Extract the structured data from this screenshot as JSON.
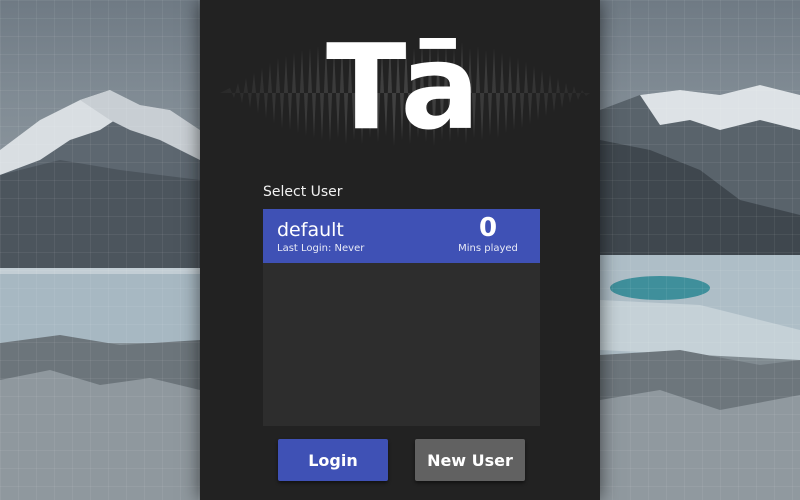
{
  "app": {
    "logo": "Tā",
    "accent_color": "#3f51b5",
    "panel_color": "#222222"
  },
  "user_select": {
    "label": "Select User",
    "users": [
      {
        "name": "default",
        "last_login": "Last Login: Never",
        "mins_played": "0",
        "mins_label": "Mins played",
        "selected": true
      }
    ]
  },
  "actions": {
    "login_label": "Login",
    "new_user_label": "New User"
  }
}
